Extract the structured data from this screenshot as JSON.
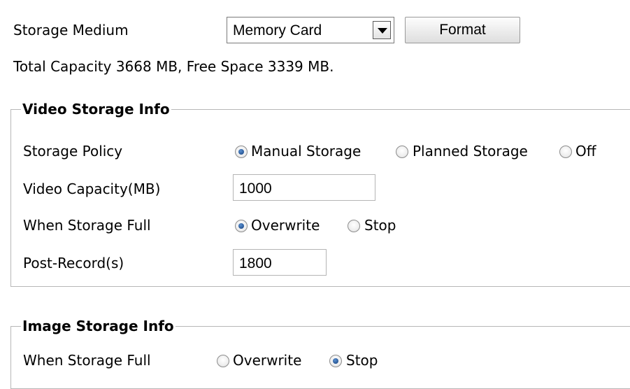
{
  "storage": {
    "medium_label": "Storage Medium",
    "medium_value": "Memory Card",
    "format_button": "Format",
    "capacity_text": "Total Capacity 3668 MB, Free Space 3339 MB."
  },
  "video": {
    "legend": "Video Storage Info",
    "policy_label": "Storage Policy",
    "policy_options": [
      "Manual Storage",
      "Planned Storage",
      "Off"
    ],
    "policy_selected": "Manual Storage",
    "capacity_label": "Video Capacity(MB)",
    "capacity_value": "1000",
    "full_label": "When Storage Full",
    "full_options": [
      "Overwrite",
      "Stop"
    ],
    "full_selected": "Overwrite",
    "postrecord_label": "Post-Record(s)",
    "postrecord_value": "1800"
  },
  "image": {
    "legend": "Image Storage Info",
    "full_label": "When Storage Full",
    "full_options": [
      "Overwrite",
      "Stop"
    ],
    "full_selected": "Stop"
  }
}
